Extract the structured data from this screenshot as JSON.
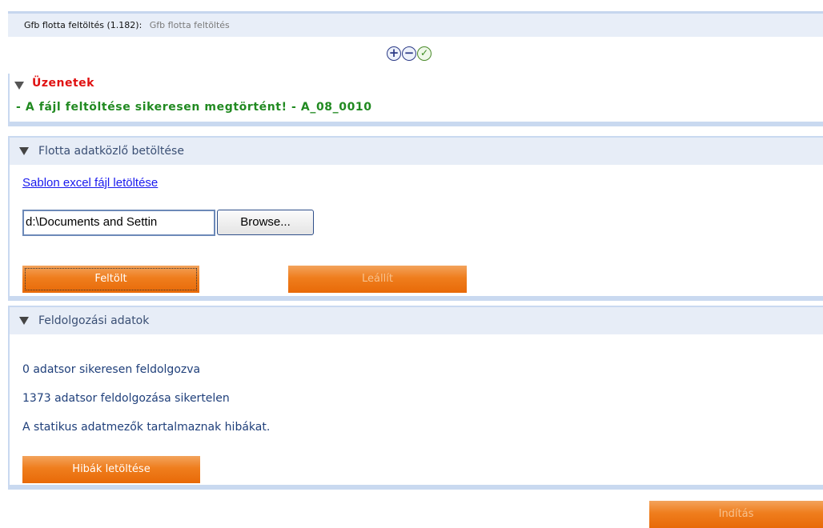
{
  "breadcrumb": {
    "main": "Gfb flotta feltöltés (1.182):",
    "sub": "Gfb flotta feltöltés"
  },
  "controls": {
    "expand_icon": "+",
    "collapse_icon": "−",
    "confirm_icon": "✓"
  },
  "messages": {
    "title": "Üzenetek",
    "line": "- A fájl feltöltése sikeresen megtörtént! - A_08_0010"
  },
  "upload": {
    "title": "Flotta adatközlő betöltése",
    "template_link": "Sablon excel fájl letöltése",
    "file_value": "d:\\Documents and Settin",
    "browse_label": "Browse...",
    "upload_label": "Feltölt",
    "stop_label": "Leállít"
  },
  "processing": {
    "title": "Feldolgozási adatok",
    "line1": "0 adatsor sikeresen feldolgozva",
    "line2": "1373 adatsor feldolgozása sikertelen",
    "line3": "A statikus adatmezők tartalmaznak hibákat.",
    "errors_button": "Hibák letöltése"
  },
  "start_button": "Indítás",
  "colors": {
    "accent_orange": "#ef7d1d",
    "header_blue": "#e7edf7",
    "error_red": "#e01010",
    "success_green": "#218a21"
  }
}
